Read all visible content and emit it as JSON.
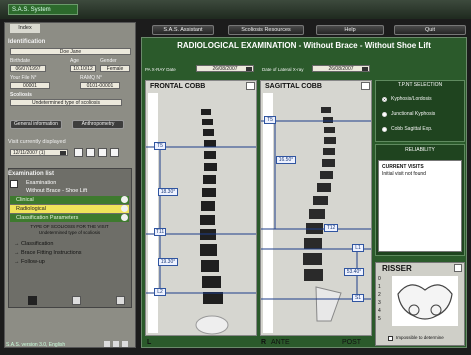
{
  "app": {
    "title": "S.A.S. System"
  },
  "top_buttons": [
    "S.A.S. Assistant",
    "Scoliosis Resources",
    "Help",
    "Quit"
  ],
  "left": {
    "tab_label": "Index",
    "identification": {
      "heading": "Identification",
      "name": "Doe Jane",
      "birthdate_label": "Birthdate",
      "birthdate": "06/07/1997",
      "age_label": "Age",
      "age": "10.10/12",
      "gender_label": "Gender",
      "gender": "Female",
      "file_label": "Your File N°",
      "file": "00001",
      "ramq_label": "RAMQ N°",
      "ramq": "0101-00001",
      "scoliosis_label": "Scoliosis",
      "scoliosis": "Undetermined type of scoliosis",
      "general_info_button": "General information",
      "anthropometry_button": "Anthropometry"
    },
    "visit": {
      "heading": "Visit currently displayed",
      "date": "12/11/2007 (1)"
    },
    "exam_list": {
      "heading": "Examination list",
      "rows": [
        "Examination",
        "Without Brace - Shoe Lift",
        "Clinical",
        "Radiological",
        "Classification Parameters"
      ],
      "type_label": "TYPE OF SCOLIOSIS FOR THE VISIT",
      "type_value": "Undetermined type of scoliosis",
      "links": [
        "→ Classification",
        "→ Brace Fitting Instructions",
        "→ Follow-up"
      ]
    },
    "footer": "S.A.S. version 3.0, English"
  },
  "main": {
    "title": "RADIOLOGICAL EXAMINATION - Without Brace - Without Shoe Lift",
    "pa_label": "PA X-RAY Date",
    "pa_date": "26/08/2007",
    "lat_label": "Date of Lateral X-ray",
    "lat_date": "26/08/2007",
    "frontal_title": "FRONTAL COBB",
    "frontal_markers": {
      "t5": "T5",
      "t11": "T11",
      "l2": "L2",
      "angle1": "18.30°",
      "angle2": "19.30°"
    },
    "frontal_bottom": "L",
    "sagittal_title": "SAGITTAL COBB",
    "sagittal_markers": {
      "t5": "T5",
      "t12": "T12",
      "l1": "L1",
      "s1": "S1",
      "angle1": "16.50°",
      "angle2": "53.40°"
    },
    "sagittal_bottom_left": "R",
    "sagittal_bottom_mid": "ANTE",
    "sagittal_bottom_right": "POST",
    "kyphosis": {
      "title": "T.P.NT SELECTION",
      "options": [
        "Kyphosis/Lordosis",
        "Junctional Kyphosis",
        "Cobb Sagittal Exp."
      ],
      "selected": 0
    },
    "reliability": {
      "title": "RELIABILITY",
      "line1": "CURRENT VISITS",
      "line2": "Initial visit not found"
    },
    "risser": {
      "title": "RISSER",
      "grades": [
        "0",
        "1",
        "2",
        "3",
        "4",
        "5"
      ],
      "impossible": "Impossible to determine"
    }
  }
}
